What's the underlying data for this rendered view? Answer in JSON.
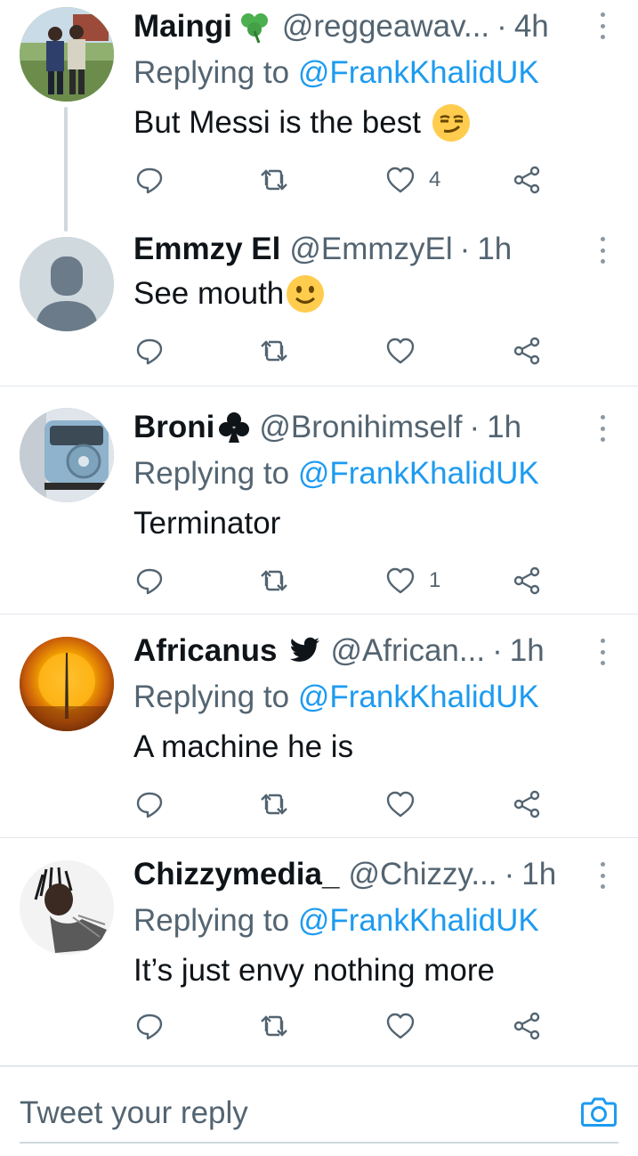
{
  "tweets": [
    {
      "name": "Maingi",
      "badge": "shamrock-icon",
      "handle": "@reggeawav...",
      "time": "4h",
      "replying_label": "Replying to",
      "replying_to": "@FrankKhalidUK",
      "text": "But Messi is the best",
      "emoji": "smirking-face",
      "likes": "4",
      "retweets": "",
      "replies": ""
    },
    {
      "name": "Emmzy El",
      "handle": "@EmmzyEl",
      "time": "1h",
      "text": "See mouth",
      "emoji": "slightly-smiling-face",
      "likes": "",
      "retweets": "",
      "replies": ""
    },
    {
      "name": "Broni",
      "badge": "club-suit-icon",
      "handle": "@Bronihimself",
      "time": "1h",
      "replying_label": "Replying to",
      "replying_to": "@FrankKhalidUK",
      "text": "Terminator",
      "likes": "1",
      "retweets": "",
      "replies": ""
    },
    {
      "name": "Africanus",
      "badge": "bird-icon",
      "handle": "@African...",
      "time": "1h",
      "replying_label": "Replying to",
      "replying_to": "@FrankKhalidUK",
      "text": "A machine he is",
      "likes": "",
      "retweets": "",
      "replies": ""
    },
    {
      "name": "Chizzymedia_",
      "handle": "@Chizzy...",
      "time": "1h",
      "replying_label": "Replying to",
      "replying_to": "@FrankKhalidUK",
      "text": "It’s just envy nothing more",
      "likes": "",
      "retweets": "",
      "replies": ""
    }
  ],
  "separator": "·",
  "reply_bar": {
    "placeholder": "Tweet your reply",
    "camera_icon": "camera-icon"
  },
  "colors": {
    "link": "#1d9bf0",
    "muted": "#536471",
    "text": "#0f1419",
    "divider": "#e1e8ed"
  }
}
